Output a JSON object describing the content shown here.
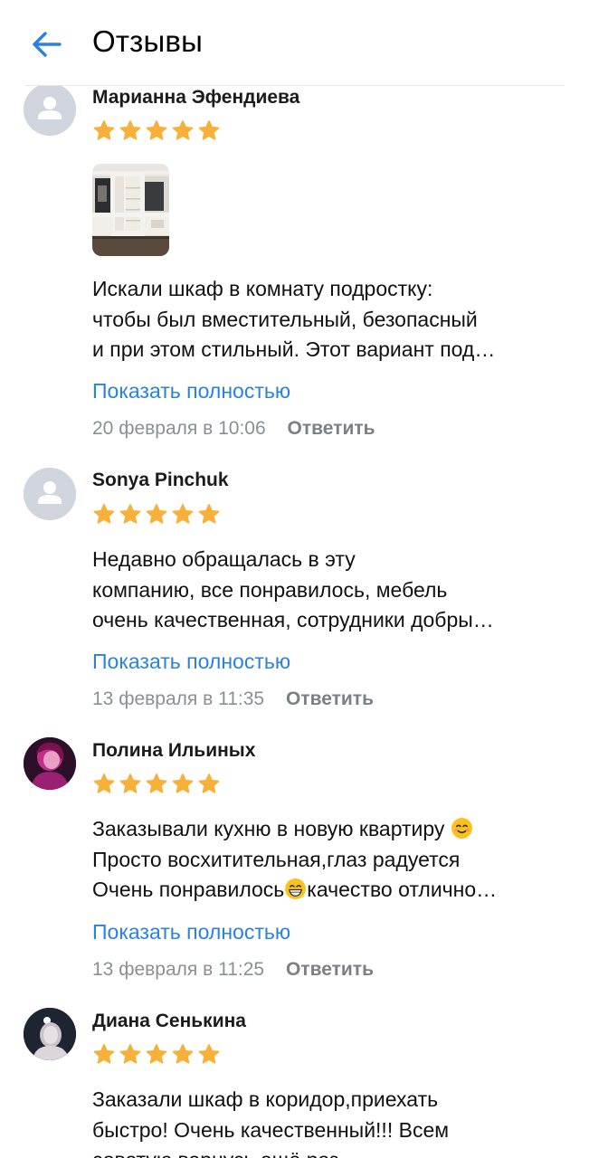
{
  "header": {
    "title": "Отзывы",
    "back_icon": "arrow-left-icon",
    "accent_color": "#2a81e0"
  },
  "reviews": [
    {
      "author": "Марианна Эфендиева",
      "avatar": "default-user-icon",
      "rating": 5,
      "has_photo": true,
      "text_lines": [
        "Искали шкаф в комнату подростку:",
        "чтобы был вместительный, безопасный",
        "и при этом стильный. Этот вариант под…"
      ],
      "show_full": "Показать полностью",
      "date": "20 февраля в 10:06",
      "reply": "Ответить"
    },
    {
      "author": "Sonya Pinchuk",
      "avatar": "default-user-icon",
      "rating": 5,
      "text_lines": [
        "Недавно обращалась в эту",
        "компанию, все понравилось, мебель",
        "очень качественная, сотрудники добры…"
      ],
      "show_full": "Показать полностью",
      "date": "13 февраля в 11:35",
      "reply": "Ответить"
    },
    {
      "author": "Полина Ильиных",
      "avatar": "user-photo-pink",
      "rating": 5,
      "text_lines": [
        "Заказывали кухню в новую квартиру",
        "Просто восхитительная,глаз радуется",
        "Очень понравилось",
        "качество отлично…"
      ],
      "show_full": "Показать полностью",
      "date": "13 февраля в 11:25",
      "reply": "Ответить"
    },
    {
      "author": "Диана Сенькина",
      "avatar": "user-photo-dark",
      "rating": 5,
      "text_lines": [
        "Заказали шкаф в коридор,приехать",
        "быстро! Очень качественный!!! Всем",
        "советую вернусь ещё раз"
      ]
    }
  ],
  "colors": {
    "star": "#f7b13b",
    "link": "#2a81e0",
    "meta": "#8a8f96",
    "avatar_placeholder": "#d1d6de"
  }
}
